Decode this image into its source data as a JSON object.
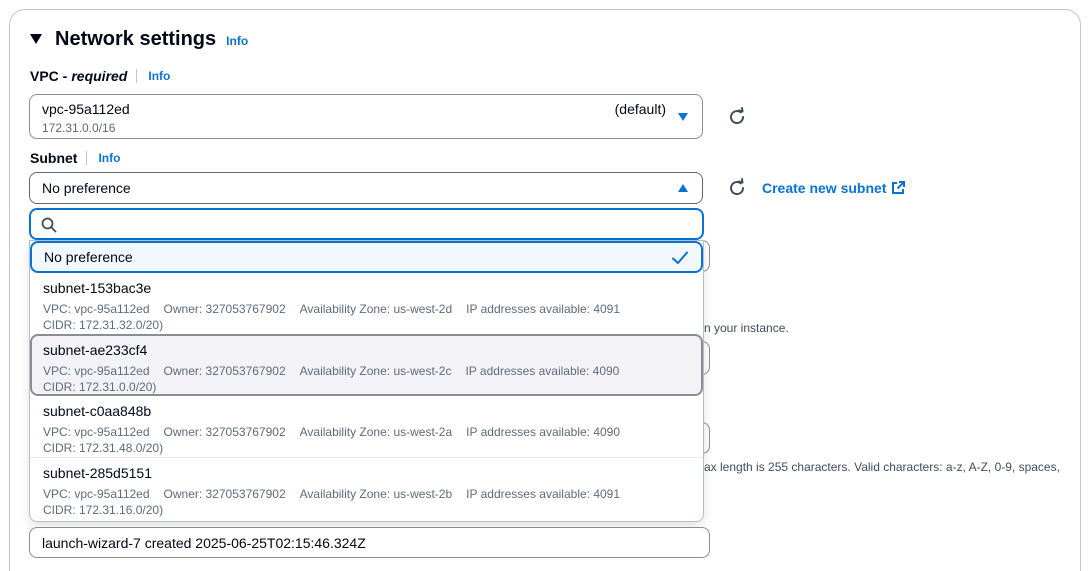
{
  "section": {
    "title": "Network settings",
    "info": "Info"
  },
  "vpc": {
    "label": "VPC - ",
    "required": "required",
    "info": "Info",
    "value": "vpc-95a112ed",
    "cidr": "172.31.0.0/16",
    "default_tag": "(default)"
  },
  "subnet": {
    "label": "Subnet",
    "info": "Info",
    "value": "No preference",
    "create_link": "Create new subnet",
    "search_value": "",
    "selected_option": "No preference",
    "options": [
      {
        "name": "subnet-153bac3e",
        "vpc": "VPC: vpc-95a112ed",
        "owner": "Owner: 327053767902",
        "az": "Availability Zone: us-west-2d",
        "ips": "IP addresses available: 4091",
        "cidr": "CIDR: 172.31.32.0/20)"
      },
      {
        "name": "subnet-ae233cf4",
        "vpc": "VPC: vpc-95a112ed",
        "owner": "Owner: 327053767902",
        "az": "Availability Zone: us-west-2c",
        "ips": "IP addresses available: 4090",
        "cidr": "CIDR: 172.31.0.0/20)"
      },
      {
        "name": "subnet-c0aa848b",
        "vpc": "VPC: vpc-95a112ed",
        "owner": "Owner: 327053767902",
        "az": "Availability Zone: us-west-2a",
        "ips": "IP addresses available: 4090",
        "cidr": "CIDR: 172.31.48.0/20)"
      },
      {
        "name": "subnet-285d5151",
        "vpc": "VPC: vpc-95a112ed",
        "owner": "Owner: 327053767902",
        "az": "Availability Zone: us-west-2b",
        "ips": "IP addresses available: 4091",
        "cidr": "CIDR: 172.31.16.0/20)"
      }
    ]
  },
  "background": {
    "hint_instance": "n your instance.",
    "hint_constraints": "ax length is 255 characters. Valid characters: a-z, A-Z, 0-9, spaces,"
  },
  "description": {
    "value": "launch-wizard-7 created 2025-06-25T02:15:46.324Z"
  },
  "colors": {
    "link": "#0972d3",
    "border": "#8c8c94",
    "selected_bg": "#f2f8fd",
    "hover_bg": "#f3f3f7"
  }
}
